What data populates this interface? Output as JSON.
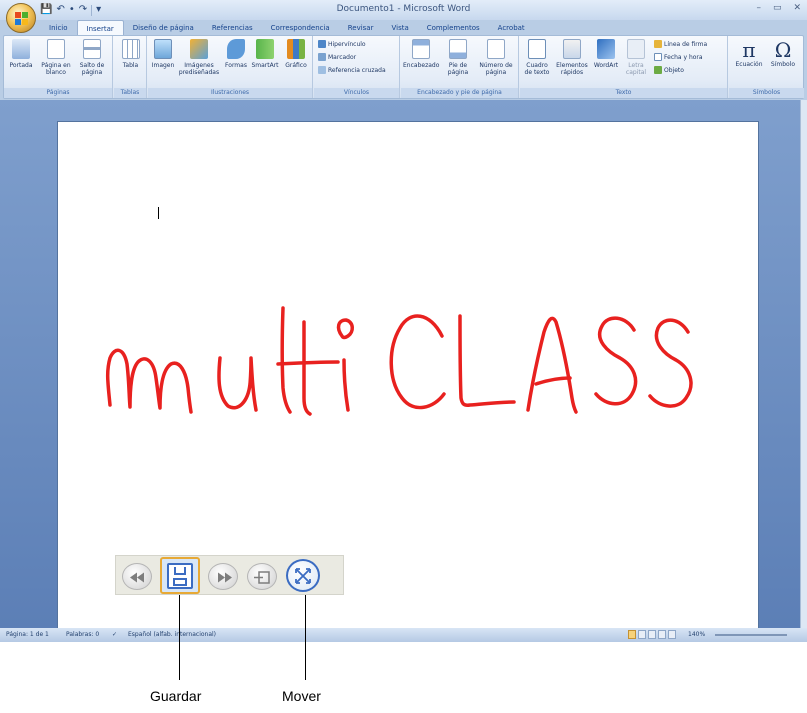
{
  "window": {
    "title": "Documento1 - Microsoft Word",
    "controls": [
      "–",
      "▭",
      "✕"
    ]
  },
  "quick_access": [
    "💾",
    "↶",
    "•",
    "↷",
    "▾"
  ],
  "tabs": [
    "Inicio",
    "Insertar",
    "Diseño de página",
    "Referencias",
    "Correspondencia",
    "Revisar",
    "Vista",
    "Complementos",
    "Acrobat"
  ],
  "active_tab": "Insertar",
  "ribbon": {
    "paginas": {
      "label": "Páginas",
      "portada": "Portada",
      "pagina_blanco": "Página en blanco",
      "salto": "Salto de página"
    },
    "tablas": {
      "label": "Tablas",
      "tabla": "Tabla"
    },
    "ilustraciones": {
      "label": "Ilustraciones",
      "imagen": "Imagen",
      "imagenes_pred": "Imágenes prediseñadas",
      "formas": "Formas",
      "smartart": "SmartArt",
      "grafico": "Gráfico"
    },
    "vinculos": {
      "label": "Vínculos",
      "hipervinculo": "Hipervínculo",
      "marcador": "Marcador",
      "referencia": "Referencia cruzada"
    },
    "encabezado": {
      "label": "Encabezado y pie de página",
      "encabezado": "Encabezado",
      "pie": "Pie de página",
      "numero": "Número de página"
    },
    "texto": {
      "label": "Texto",
      "cuadro": "Cuadro de texto",
      "elementos": "Elementos rápidos",
      "wordart": "WordArt",
      "letra": "Letra capital",
      "linea_firma": "Línea de firma",
      "fecha": "Fecha y hora",
      "objeto": "Objeto"
    },
    "simbolos": {
      "label": "Símbolos",
      "ecuacion": "Ecuación",
      "simbolo": "Símbolo",
      "pi_glyph": "π",
      "omega_glyph": "Ω"
    }
  },
  "document": {
    "handwriting": "multiCLASS",
    "ink_color": "#e8211f"
  },
  "status": {
    "page": "Página: 1 de 1",
    "words": "Palabras: 0",
    "language": "Español (alfab. internacional)",
    "zoom": "140%"
  },
  "mc_toolbar": {
    "buttons": [
      "rewind-icon",
      "save-icon",
      "forward-icon",
      "exit-icon",
      "move-icon"
    ],
    "active_button": "save-icon"
  },
  "callouts": {
    "save": "Guardar",
    "move": "Mover"
  }
}
